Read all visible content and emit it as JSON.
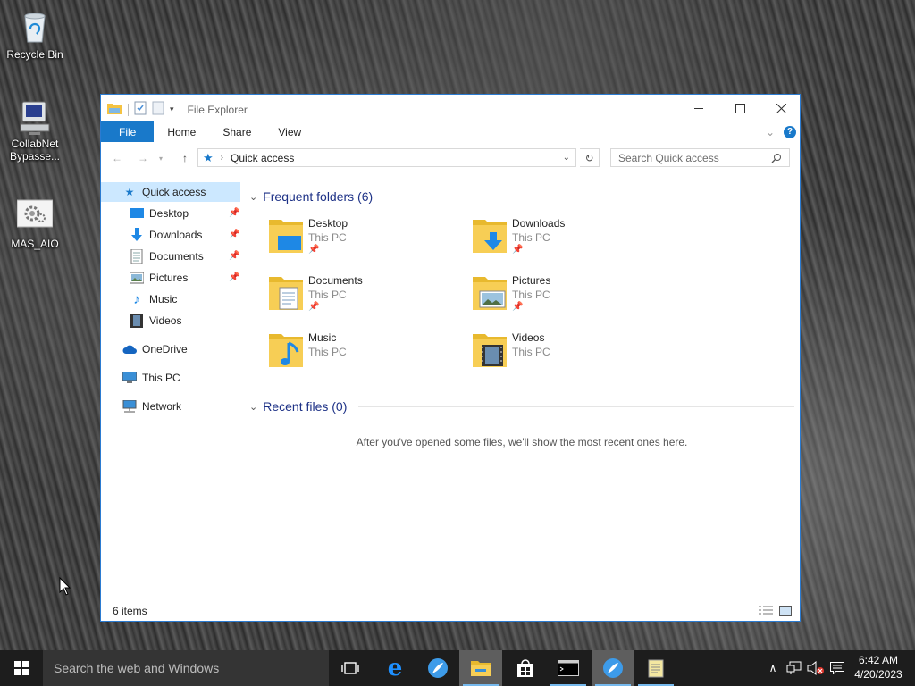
{
  "desktop": {
    "icons": [
      {
        "label": "Recycle Bin",
        "icon": "recycle-bin-icon"
      },
      {
        "label": "CollabNet Bypasse...",
        "icon": "computer-icon"
      },
      {
        "label": "MAS_AIO",
        "icon": "gear-icon"
      }
    ]
  },
  "window": {
    "title": "File Explorer",
    "tabs": [
      "File",
      "Home",
      "Share",
      "View"
    ],
    "address": {
      "location": "Quick access"
    },
    "search": {
      "placeholder": "Search Quick access"
    },
    "nav": {
      "items": [
        {
          "label": "Quick access",
          "icon": "star-icon"
        },
        {
          "label": "Desktop",
          "icon": "desktop-icon",
          "pinned": true
        },
        {
          "label": "Downloads",
          "icon": "downloads-icon",
          "pinned": true
        },
        {
          "label": "Documents",
          "icon": "documents-icon",
          "pinned": true
        },
        {
          "label": "Pictures",
          "icon": "pictures-icon",
          "pinned": true
        },
        {
          "label": "Music",
          "icon": "music-icon"
        },
        {
          "label": "Videos",
          "icon": "videos-icon"
        },
        {
          "label": "OneDrive",
          "icon": "cloud-icon"
        },
        {
          "label": "This PC",
          "icon": "this-pc-icon"
        },
        {
          "label": "Network",
          "icon": "network-icon"
        }
      ]
    },
    "frequent": {
      "header": "Frequent folders (6)",
      "folders": [
        {
          "name": "Desktop",
          "location": "This PC",
          "pinned": true
        },
        {
          "name": "Downloads",
          "location": "This PC",
          "pinned": true
        },
        {
          "name": "Documents",
          "location": "This PC",
          "pinned": true
        },
        {
          "name": "Pictures",
          "location": "This PC",
          "pinned": true
        },
        {
          "name": "Music",
          "location": "This PC",
          "pinned": false
        },
        {
          "name": "Videos",
          "location": "This PC",
          "pinned": false
        }
      ]
    },
    "recent": {
      "header": "Recent files (0)",
      "empty_message": "After you've opened some files, we'll show the most recent ones here."
    },
    "status": {
      "item_count": "6 items"
    }
  },
  "taskbar": {
    "search_placeholder": "Search the web and Windows",
    "time": "6:42 AM",
    "date": "4/20/2023"
  },
  "colors": {
    "accent": "#1979ca",
    "header": "#1e3287",
    "folder": "#f5c342"
  }
}
